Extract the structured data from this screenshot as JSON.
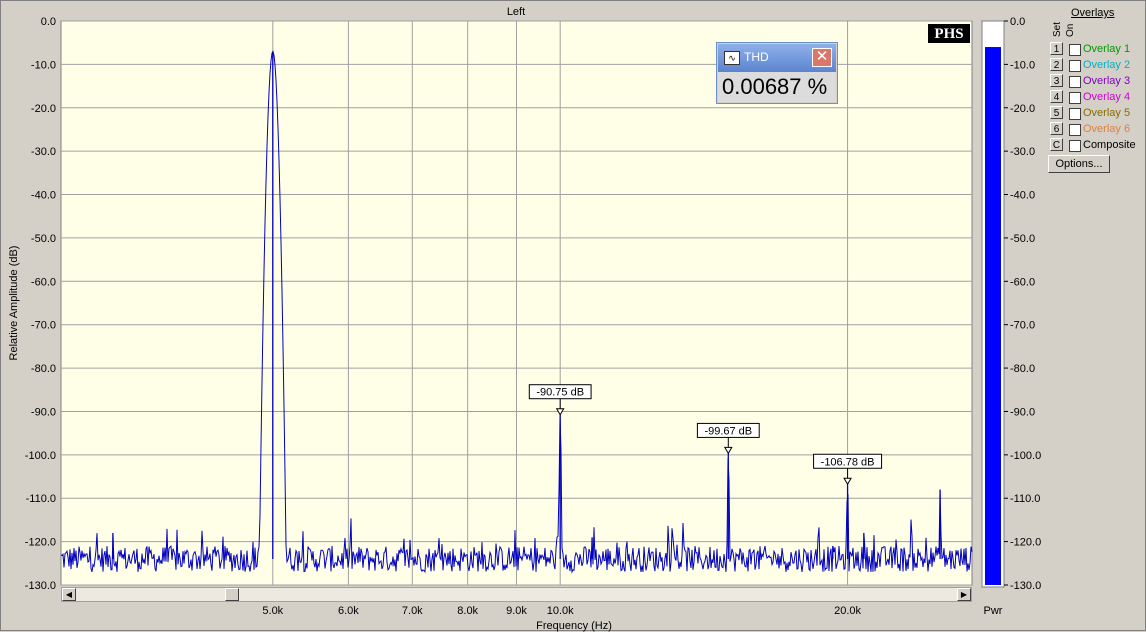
{
  "chart_data": {
    "type": "line",
    "title": "Left",
    "xlabel": "Frequency (Hz)",
    "ylabel": "Relative Amplitude (dB)",
    "x_scale": "log",
    "xlim": [
      3000,
      27000
    ],
    "ylim": [
      -130,
      0
    ],
    "x_ticks": [
      {
        "value": 5000,
        "label": "5.0k"
      },
      {
        "value": 6000,
        "label": "6.0k"
      },
      {
        "value": 7000,
        "label": "7.0k"
      },
      {
        "value": 8000,
        "label": "8.0k"
      },
      {
        "value": 9000,
        "label": "9.0k"
      },
      {
        "value": 10000,
        "label": "10.0k"
      },
      {
        "value": 20000,
        "label": "20.0k"
      }
    ],
    "y_ticks": [
      {
        "value": 0,
        "label": "0.0"
      },
      {
        "value": -10,
        "label": "-10.0"
      },
      {
        "value": -20,
        "label": "-20.0"
      },
      {
        "value": -30,
        "label": "-30.0"
      },
      {
        "value": -40,
        "label": "-40.0"
      },
      {
        "value": -50,
        "label": "-50.0"
      },
      {
        "value": -60,
        "label": "-60.0"
      },
      {
        "value": -70,
        "label": "-70.0"
      },
      {
        "value": -80,
        "label": "-80.0"
      },
      {
        "value": -90,
        "label": "-90.0"
      },
      {
        "value": -100,
        "label": "-100.0"
      },
      {
        "value": -110,
        "label": "-110.0"
      },
      {
        "value": -120,
        "label": "-120.0"
      },
      {
        "value": -130,
        "label": "-130.0"
      }
    ],
    "grid": true,
    "noise_floor_db": -124,
    "peaks": [
      {
        "freq": 3400,
        "db": -118
      },
      {
        "freq": 5000,
        "db": -7
      },
      {
        "freq": 10000,
        "db": -90.75
      },
      {
        "freq": 10800,
        "db": -119
      },
      {
        "freq": 15000,
        "db": -99.67
      },
      {
        "freq": 19300,
        "db": -121
      },
      {
        "freq": 20000,
        "db": -106.78
      },
      {
        "freq": 20800,
        "db": -118
      },
      {
        "freq": 25000,
        "db": -108
      }
    ],
    "markers": [
      {
        "freq": 10000,
        "db": -90.75,
        "label": "-90.75 dB"
      },
      {
        "freq": 15000,
        "db": -99.67,
        "label": "-99.67 dB"
      },
      {
        "freq": 20000,
        "db": -106.78,
        "label": "-106.78 dB"
      }
    ],
    "power_meter": {
      "label": "Pwr",
      "level_db": -6,
      "range": [
        -130,
        0
      ]
    }
  },
  "thd_window": {
    "title": "THD",
    "value": "0.00687 %",
    "icon": "waveform-icon"
  },
  "brand_label": "PHS",
  "overlays": {
    "title": "Overlays",
    "set_label": "Set",
    "on_label": "On",
    "items": [
      {
        "key": "1",
        "label": "Overlay 1",
        "color": "#009900"
      },
      {
        "key": "2",
        "label": "Overlay 2",
        "color": "#00b0c0"
      },
      {
        "key": "3",
        "label": "Overlay 3",
        "color": "#8000c0"
      },
      {
        "key": "4",
        "label": "Overlay 4",
        "color": "#d000d0"
      },
      {
        "key": "5",
        "label": "Overlay 5",
        "color": "#8a6a00"
      },
      {
        "key": "6",
        "label": "Overlay 6",
        "color": "#e08040"
      },
      {
        "key": "C",
        "label": "Composite",
        "color": "#000000"
      }
    ],
    "options_label": "Options..."
  },
  "colors": {
    "plot_bg": "#ffffe8",
    "trace": "#0000c0",
    "meter": "#0000ff",
    "grid": "#a0a0a0"
  }
}
